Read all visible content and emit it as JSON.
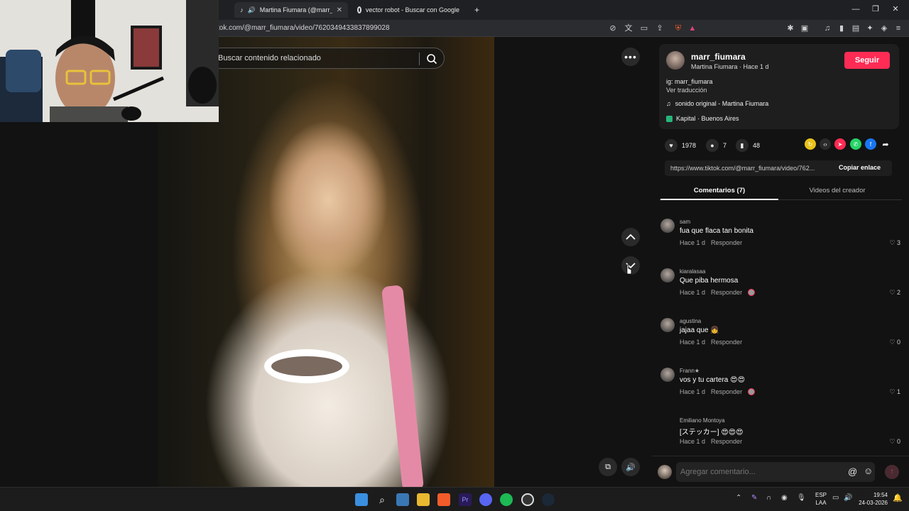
{
  "browser": {
    "tabs": [
      {
        "title": "Martina Fiumara (@marr_fiun",
        "active": true
      },
      {
        "title": "vector robot - Buscar con Google",
        "active": false
      }
    ],
    "new_tab": "+",
    "url": "tok.com/@marr_fiumara/video/7620349433837899028"
  },
  "video": {
    "search_placeholder": "Buscar contenido relacionado"
  },
  "creator": {
    "username": "marr_fiumara",
    "subline": "Martina Fiumara · Hace 1 d",
    "follow_label": "Seguir",
    "description": "ig: marr_fiumara",
    "translate": "Ver traducción",
    "sound": "sonido original - Martina Fiumara",
    "location": "Kapital · Buenos Aires"
  },
  "stats": {
    "likes": "1978",
    "comments": "7",
    "saves": "48"
  },
  "share": {
    "link": "https://www.tiktok.com/@marr_fiumara/video/762...",
    "copy_label": "Copiar enlace"
  },
  "panel_tabs": [
    {
      "label": "Comentarios (7)",
      "active": true
    },
    {
      "label": "Videos del creador",
      "active": false
    }
  ],
  "comments": [
    {
      "name": "sam",
      "text": "fua que flaca tan bonita",
      "time": "Hace 1 d",
      "reply": "Responder",
      "likes": "3"
    },
    {
      "name": "kiaralasaa",
      "text": "Que piba hermosa",
      "time": "Hace 1 d",
      "reply": "Responder",
      "likes": "2"
    },
    {
      "name": "agustina",
      "text": "jajaa que 👧",
      "time": "Hace 1 d",
      "reply": "Responder",
      "likes": "0"
    },
    {
      "name": "Frann★",
      "text": "vos y tu cartera 😍😍",
      "time": "Hace 1 d",
      "reply": "Responder",
      "likes": "1"
    },
    {
      "name": "Emiliano Montoya",
      "text": "[ステッカー] 😍😍😍",
      "time": "Hace 1 d",
      "reply": "Responder",
      "likes": "0"
    }
  ],
  "comment_box": {
    "placeholder": "Agregar comentario..."
  },
  "taskbar": {
    "lang_line1": "ESP",
    "lang_line2": "LAA",
    "time": "19:54",
    "date": "24-03-2026"
  },
  "colors": {
    "accent": "#fe2c55",
    "background": "#121212"
  }
}
